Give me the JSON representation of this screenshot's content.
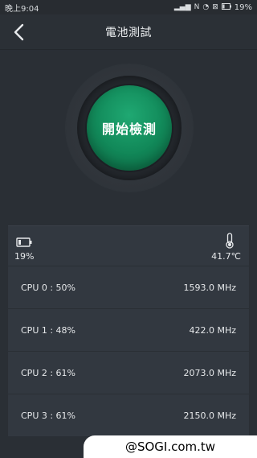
{
  "status_bar": {
    "time": "晚上9:04",
    "battery": "19%"
  },
  "app_bar": {
    "title": "電池測試"
  },
  "hero": {
    "start_label": "開始檢測",
    "button_color": "#128a5a"
  },
  "sensors": {
    "battery": "19%",
    "temperature": "41.7℃"
  },
  "cpus": [
    {
      "label": "CPU  0 : 50%",
      "freq": "1593.0 MHz"
    },
    {
      "label": "CPU  1 : 48%",
      "freq": "422.0 MHz"
    },
    {
      "label": "CPU  2 : 61%",
      "freq": "2073.0 MHz"
    },
    {
      "label": "CPU  3 : 61%",
      "freq": "2150.0 MHz"
    }
  ],
  "watermark": "@SOGI.com.tw"
}
